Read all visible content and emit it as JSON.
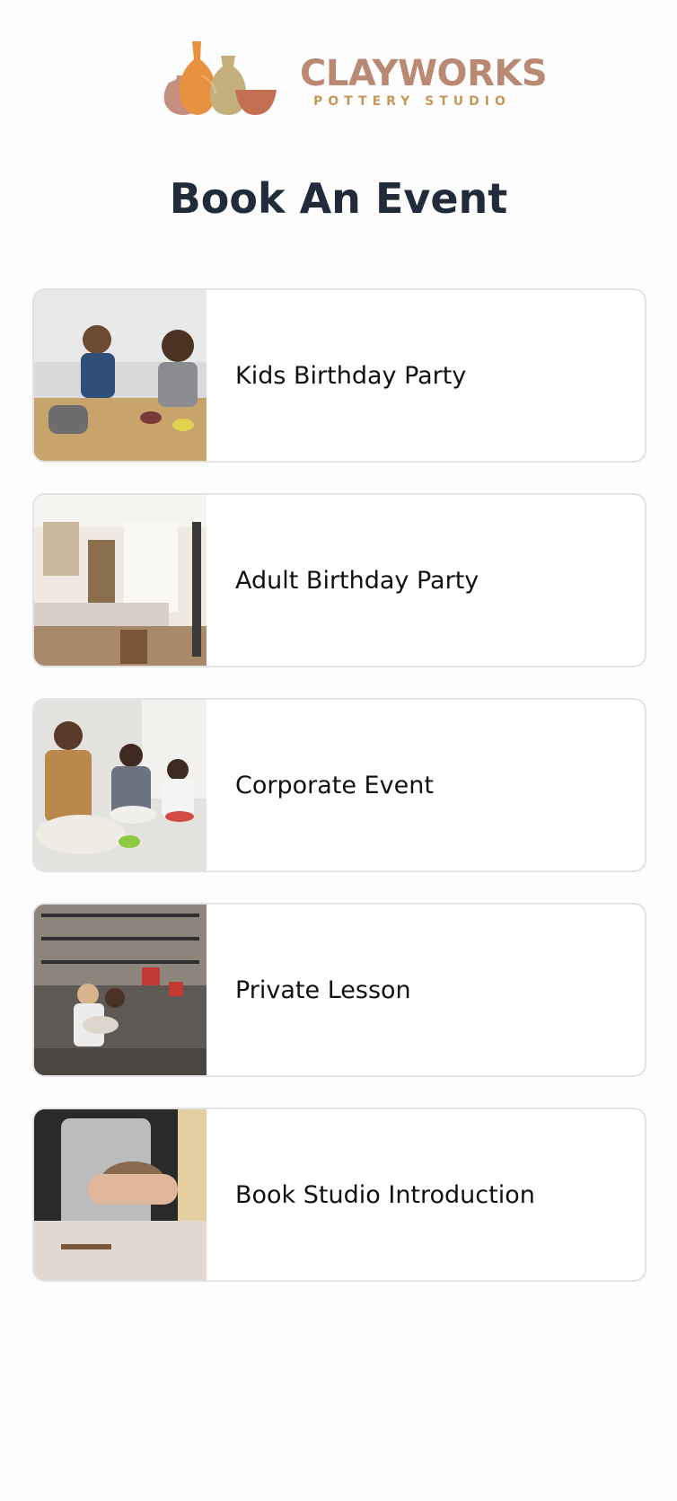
{
  "brand": {
    "name": "CLAYWORKS",
    "tagline": "POTTERY STUDIO",
    "colors": {
      "primary": "#b98973",
      "secondary": "#c39a5c",
      "accent": "#e8913f"
    }
  },
  "page": {
    "title": "Book An Event"
  },
  "events": [
    {
      "label": "Kids Birthday Party",
      "image": "children-painting-pottery-photo"
    },
    {
      "label": "Adult Birthday Party",
      "image": "studio-interior-photo"
    },
    {
      "label": "Corporate Event",
      "image": "adults-at-pottery-wheels-photo"
    },
    {
      "label": "Private Lesson",
      "image": "studio-shelves-lesson-photo"
    },
    {
      "label": "Book Studio Introduction",
      "image": "hands-shaping-clay-photo"
    }
  ],
  "colors": {
    "title": "#222b3c",
    "card_border": "#e3e3e6",
    "background": "#fefdfd"
  }
}
